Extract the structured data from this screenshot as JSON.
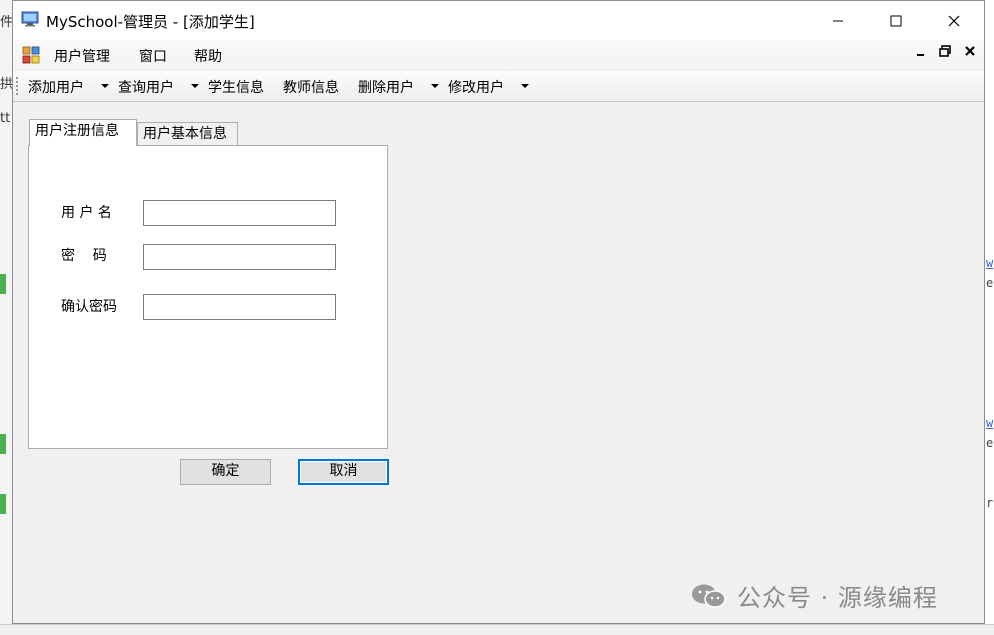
{
  "window": {
    "title": "MySchool-管理员 - [添加学生]"
  },
  "menubar": {
    "items": [
      "用户管理",
      "窗口",
      "帮助"
    ]
  },
  "toolbar": {
    "items": [
      {
        "label": "添加用户",
        "dropdown": true
      },
      {
        "label": "查询用户",
        "dropdown": true
      },
      {
        "label": "学生信息",
        "dropdown": false
      },
      {
        "label": "教师信息",
        "dropdown": false
      },
      {
        "label": "删除用户",
        "dropdown": true
      },
      {
        "label": "修改用户",
        "dropdown": true
      }
    ]
  },
  "tabs": [
    {
      "label": "用户注册信息",
      "active": true
    },
    {
      "label": "用户基本信息",
      "active": false
    }
  ],
  "form": {
    "username_label": "用 户 名",
    "password_label": "密    码",
    "confirm_label": "确认密码",
    "username_value": "",
    "password_value": "",
    "confirm_value": ""
  },
  "buttons": {
    "ok": "确定",
    "cancel": "取消"
  },
  "watermark": "公众号 · 源缘编程",
  "background": {
    "left_chars": [
      "件",
      "拱",
      "tt"
    ],
    "right_chars": [
      "w",
      "e",
      "w",
      "e",
      "r"
    ]
  },
  "colors": {
    "focus": "#0078d7",
    "window_bg": "#f0f0f0"
  }
}
